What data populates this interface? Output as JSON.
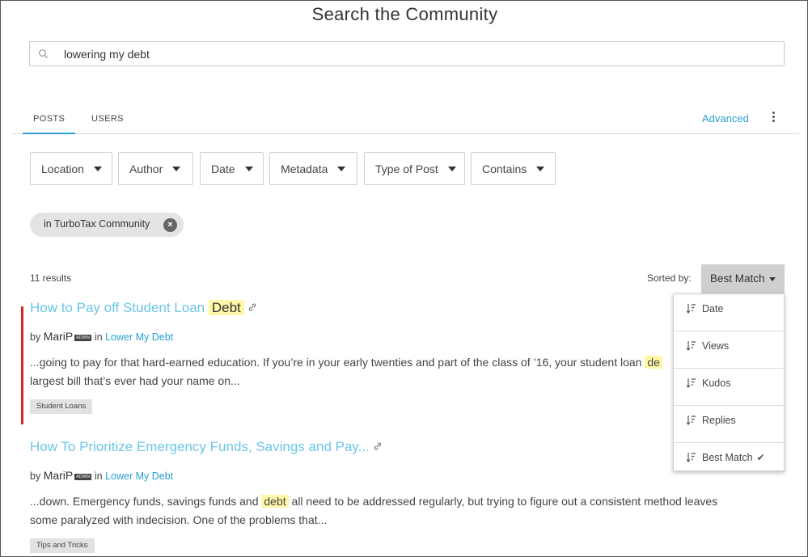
{
  "page": {
    "title": "Search the Community"
  },
  "search": {
    "value": "lowering my debt"
  },
  "tabs": [
    {
      "label": "POSTS",
      "active": true
    },
    {
      "label": "USERS",
      "active": false
    }
  ],
  "advanced_label": "Advanced",
  "filters": [
    "Location",
    "Author",
    "Date",
    "Metadata",
    "Type of Post",
    "Contains"
  ],
  "chip": {
    "label": "in TurboTax Community"
  },
  "results": {
    "count_label": "11 results"
  },
  "sort": {
    "label": "Sorted by:",
    "selected": "Best Match",
    "options": [
      "Date",
      "Views",
      "Kudos",
      "Replies",
      "Best Match"
    ]
  },
  "posts": [
    {
      "title_prefix": "How to Pay off Student Loan",
      "title_highlight": "Debt",
      "by": "by",
      "author": "MariP",
      "badge": "ADMIN",
      "in": "in",
      "board": "Lower My Debt",
      "snippet_line1_a": "...going to pay for that hard-earned education.   If you’re in your early twenties and part of the class of ’16, your student loan",
      "snippet_line1_hl": "de",
      "snippet_line2": "largest bill that’s ever had your name on...",
      "tag": "Student Loans"
    },
    {
      "title_prefix": "How To Prioritize Emergency Funds, Savings and Pay...",
      "by": "by",
      "author": "MariP",
      "badge": "ADMIN",
      "in": "in",
      "board": "Lower My Debt",
      "snippet_line1_a": "...down. Emergency funds, savings funds and",
      "snippet_line1_hl": "debt",
      "snippet_line1_b": "all need to be addressed regularly, but trying to figure out a consistent method leaves",
      "snippet_line2": "some paralyzed with indecision.   One of the problems that...",
      "tag": "Tips and Tricks"
    }
  ],
  "colors": {
    "link": "#2a9fd6",
    "title_link": "#6cc6e8",
    "highlight": "#fff7a8",
    "accent_bar": "#d9262b"
  }
}
